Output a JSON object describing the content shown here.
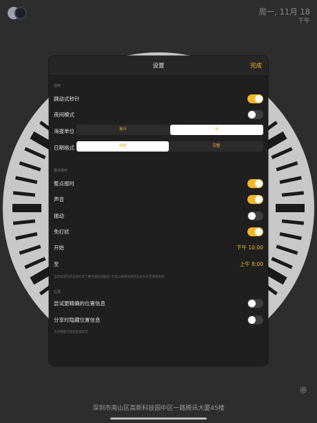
{
  "status": {
    "date_line": "周一, 11月 18",
    "ampm": "下午"
  },
  "background": {
    "address": "深圳市南山区高新科技园中区一路腾讯大厦45楼"
  },
  "settings": {
    "title": "设置",
    "done_label": "完成",
    "section_display": "通用",
    "rows_display": [
      {
        "label": "跳动式秒针",
        "toggle": true
      },
      {
        "label": "夜间模式",
        "toggle": false
      }
    ],
    "altitude": {
      "label": "海拔单位",
      "options": [
        "英尺",
        "米"
      ],
      "selected_index": 1
    },
    "date_format": {
      "label": "日期格式",
      "options": [
        "简略",
        "完整"
      ],
      "selected_index": 0
    },
    "section_chime": "整点报时",
    "rows_chime": [
      {
        "label": "整点报时",
        "toggle": true
      },
      {
        "label": "声音",
        "toggle": true
      },
      {
        "label": "振动",
        "toggle": false
      },
      {
        "label": "免打扰",
        "toggle": true
      }
    ],
    "start": {
      "label": "开始",
      "value": "下午 10:00"
    },
    "end": {
      "label": "至",
      "value": "上午 8:00"
    },
    "chime_note": "当您希望在开启后打开了整点报时功能后, 仍可以按照规则的方式为声音或者振动",
    "section_location": "位置",
    "rows_location": [
      {
        "label": "尝试更精确的位置信息",
        "toggle": false
      },
      {
        "label": "分享时隐藏位置信息",
        "toggle": false
      }
    ],
    "location_note": "允许数据可能会出现延迟"
  },
  "colors": {
    "accent": "#f2b829",
    "modal_bg": "#1f1f1f",
    "page_bg": "#2d2d2d"
  }
}
